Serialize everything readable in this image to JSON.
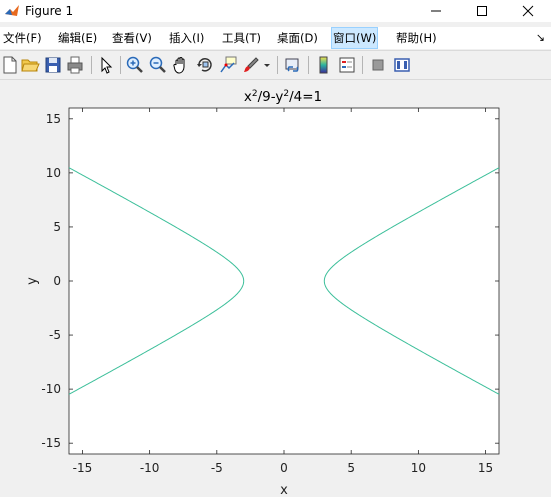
{
  "window": {
    "title": "Figure 1",
    "controls": {
      "minimize": "—",
      "maximize": "☐",
      "close": "✕"
    }
  },
  "menubar": {
    "items": [
      {
        "label": "文件(F)",
        "active": false
      },
      {
        "label": "编辑(E)",
        "active": false
      },
      {
        "label": "查看(V)",
        "active": false
      },
      {
        "label": "插入(I)",
        "active": false
      },
      {
        "label": "工具(T)",
        "active": false
      },
      {
        "label": "桌面(D)",
        "active": false
      },
      {
        "label": "窗口(W)",
        "active": true
      },
      {
        "label": "帮助(H)",
        "active": false
      }
    ],
    "overflow_icon": "dock-arrow-icon"
  },
  "toolbar": {
    "buttons": [
      "new-figure-icon",
      "open-file-icon",
      "save-icon",
      "print-icon",
      "edit-plot-arrow-icon",
      "zoom-in-icon",
      "zoom-out-icon",
      "pan-hand-icon",
      "rotate-3d-icon",
      "data-cursor-icon",
      "brush-icon",
      "link-plot-icon",
      "colorbar-icon",
      "legend-icon",
      "hide-plot-tools-icon",
      "show-plot-tools-icon"
    ]
  },
  "chart_data": {
    "type": "line",
    "title": "x²/9-y²/4=1",
    "title_base_1": "x",
    "title_sup_1": "2",
    "title_mid": "/9-y",
    "title_sup_2": "2",
    "title_end": "/4=1",
    "xlabel": "x",
    "ylabel": "y",
    "xlim": [
      -16,
      16
    ],
    "ylim": [
      -16,
      16
    ],
    "xticks": [
      -15,
      -10,
      -5,
      0,
      5,
      10,
      15
    ],
    "yticks": [
      -15,
      -10,
      -5,
      0,
      5,
      10,
      15
    ],
    "grid": false,
    "line_color": "#3cbf9a",
    "equation": {
      "a_squared": 9,
      "b_squared": 4
    },
    "series": [
      {
        "branch": "right",
        "x": [
          3,
          3.05,
          3.2,
          3.5,
          4,
          5,
          6,
          7,
          8,
          10,
          12,
          14,
          16
        ],
        "y_pos": [
          0,
          0.37,
          0.71,
          1.2,
          1.76,
          2.67,
          3.46,
          4.22,
          4.94,
          6.36,
          7.75,
          9.11,
          10.48
        ]
      },
      {
        "branch": "left",
        "x": [
          -3,
          -3.05,
          -3.2,
          -3.5,
          -4,
          -5,
          -6,
          -7,
          -8,
          -10,
          -12,
          -14,
          -16
        ],
        "y_pos": [
          0,
          0.37,
          0.71,
          1.2,
          1.76,
          2.67,
          3.46,
          4.22,
          4.94,
          6.36,
          7.75,
          9.11,
          10.48
        ]
      }
    ]
  }
}
